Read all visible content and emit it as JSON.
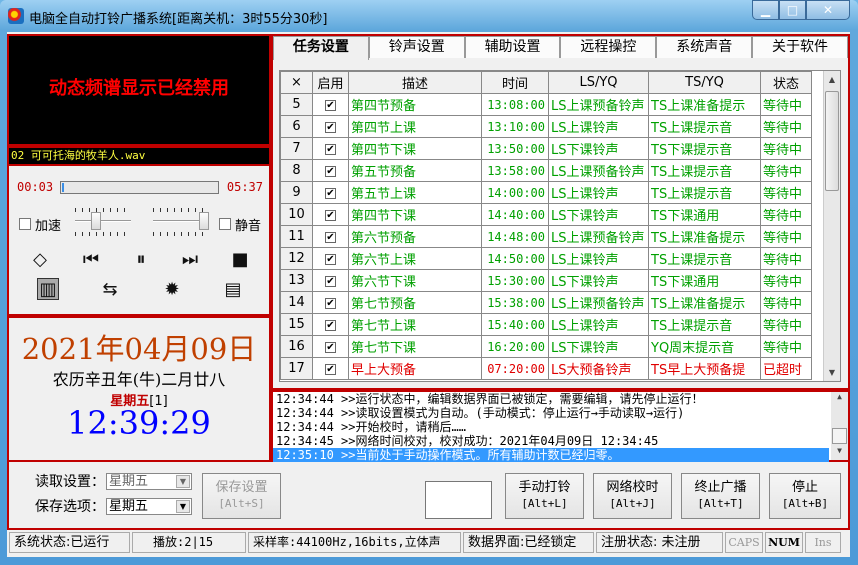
{
  "window": {
    "title": "电脑全自动打铃广播系统[距离关机：3时55分30秒]",
    "min_label": "▁",
    "max_label": "□",
    "close_label": "✕"
  },
  "player": {
    "spectrum_message": "动态频谱显示已经禁用",
    "track_name": "02 可可托海的牧羊人.wav",
    "time_current": "00:03",
    "time_total": "05:37",
    "progress_percent": 1,
    "speed_label": "加速",
    "speed_checked": false,
    "mute_label": "静音",
    "mute_checked": false,
    "speed_slider_level": 0.35,
    "volume_slider_level": 1.0,
    "icons": {
      "loop": "◇",
      "prev": "⏮",
      "pause": "⏸",
      "next": "⏭",
      "stop": "■",
      "equalizer": "▥",
      "switch": "⇆",
      "settings": "✹",
      "list": "▤"
    }
  },
  "datetime": {
    "date": "2021年04月09日",
    "lunar": "农历辛丑年(牛)二月廿八",
    "weekday": "星期五",
    "weekday_index": "[1]",
    "clock": "12:39:29"
  },
  "tabs": [
    "任务设置",
    "铃声设置",
    "辅助设置",
    "远程操控",
    "系统声音",
    "关于软件"
  ],
  "active_tab": 0,
  "table": {
    "headers": [
      "×",
      "启用",
      "描述",
      "时间",
      "LS/YQ",
      "TS/YQ",
      "状态"
    ],
    "rows": [
      {
        "no": "5",
        "enabled": true,
        "desc": "第四节预备",
        "time": "13:08:00",
        "ls": "LS上课预备铃声",
        "ts": "TS上课准备提示",
        "status": "等待中",
        "color": "green"
      },
      {
        "no": "6",
        "enabled": true,
        "desc": "第四节上课",
        "time": "13:10:00",
        "ls": "LS上课铃声",
        "ts": "TS上课提示音",
        "status": "等待中",
        "color": "green"
      },
      {
        "no": "7",
        "enabled": true,
        "desc": "第四节下课",
        "time": "13:50:00",
        "ls": "LS下课铃声",
        "ts": "TS下课提示音",
        "status": "等待中",
        "color": "green"
      },
      {
        "no": "8",
        "enabled": true,
        "desc": "第五节预备",
        "time": "13:58:00",
        "ls": "LS上课预备铃声",
        "ts": "TS上课提示音",
        "status": "等待中",
        "color": "green"
      },
      {
        "no": "9",
        "enabled": true,
        "desc": "第五节上课",
        "time": "14:00:00",
        "ls": "LS上课铃声",
        "ts": "TS上课提示音",
        "status": "等待中",
        "color": "green"
      },
      {
        "no": "10",
        "enabled": true,
        "desc": "第四节下课",
        "time": "14:40:00",
        "ls": "LS下课铃声",
        "ts": "TS下课通用",
        "status": "等待中",
        "color": "green"
      },
      {
        "no": "11",
        "enabled": true,
        "desc": "第六节预备",
        "time": "14:48:00",
        "ls": "LS上课预备铃声",
        "ts": "TS上课准备提示",
        "status": "等待中",
        "color": "green"
      },
      {
        "no": "12",
        "enabled": true,
        "desc": "第六节上课",
        "time": "14:50:00",
        "ls": "LS上课铃声",
        "ts": "TS上课提示音",
        "status": "等待中",
        "color": "green"
      },
      {
        "no": "13",
        "enabled": true,
        "desc": "第六节下课",
        "time": "15:30:00",
        "ls": "LS下课铃声",
        "ts": "TS下课通用",
        "status": "等待中",
        "color": "green"
      },
      {
        "no": "14",
        "enabled": true,
        "desc": "第七节预备",
        "time": "15:38:00",
        "ls": "LS上课预备铃声",
        "ts": "TS上课准备提示",
        "status": "等待中",
        "color": "green"
      },
      {
        "no": "15",
        "enabled": true,
        "desc": "第七节上课",
        "time": "15:40:00",
        "ls": "LS上课铃声",
        "ts": "TS上课提示音",
        "status": "等待中",
        "color": "green"
      },
      {
        "no": "16",
        "enabled": true,
        "desc": "第七节下课",
        "time": "16:20:00",
        "ls": "LS下课铃声",
        "ts": "YQ周末提示音",
        "status": "等待中",
        "color": "green"
      },
      {
        "no": "17",
        "enabled": true,
        "desc": "早上大预备",
        "time": "07:20:00",
        "ls": "LS大预备铃声",
        "ts": "TS早上大预备提",
        "status": "已超时",
        "color": "red"
      }
    ]
  },
  "log": [
    {
      "text": "12:34:44 >>运行状态中，编辑数据界面已被锁定，需要编辑，请先停止运行！",
      "selected": false
    },
    {
      "text": "12:34:44 >>读取设置模式为自动。(手动模式：停止运行→手动读取→运行)",
      "selected": false
    },
    {
      "text": "12:34:44 >>开始校时，请稍后……",
      "selected": false
    },
    {
      "text": "12:34:45 >>网络时间校对，校对成功：2021年04月09日 12:34:45",
      "selected": false
    },
    {
      "text": "12:35:10 >>当前处于手动操作模式。所有辅助计数已经归零。",
      "selected": true
    }
  ],
  "controls": {
    "read_label": "读取设置：",
    "read_value": "星期五",
    "save_option_label": "保存选项：",
    "save_option_value": "星期五",
    "save_settings": {
      "label": "保存设置",
      "shortcut": "[Alt+S]"
    },
    "manual_ring": {
      "label": "手动打铃",
      "shortcut": "[Alt+L]"
    },
    "net_time": {
      "label": "网络校时",
      "shortcut": "[Alt+J]"
    },
    "stop_broadcast": {
      "label": "终止广播",
      "shortcut": "[Alt+T]"
    },
    "stop": {
      "label": "停止",
      "shortcut": "[Alt+B]"
    }
  },
  "statusbar": {
    "system": "系统状态:已运行",
    "play": "播放:2|15",
    "sample": "采样率:44100Hz,16bits,立体声",
    "data_ui": "数据界面:已经锁定",
    "register": "注册状态: 未注册",
    "caps": "CAPS",
    "num": "NUM",
    "ins": "Ins"
  },
  "colors": {
    "accent_red": "#c00000",
    "row_green": "#00a000",
    "row_red": "#e00000",
    "clock_blue": "#0000ff",
    "selection": "#3399ff"
  }
}
